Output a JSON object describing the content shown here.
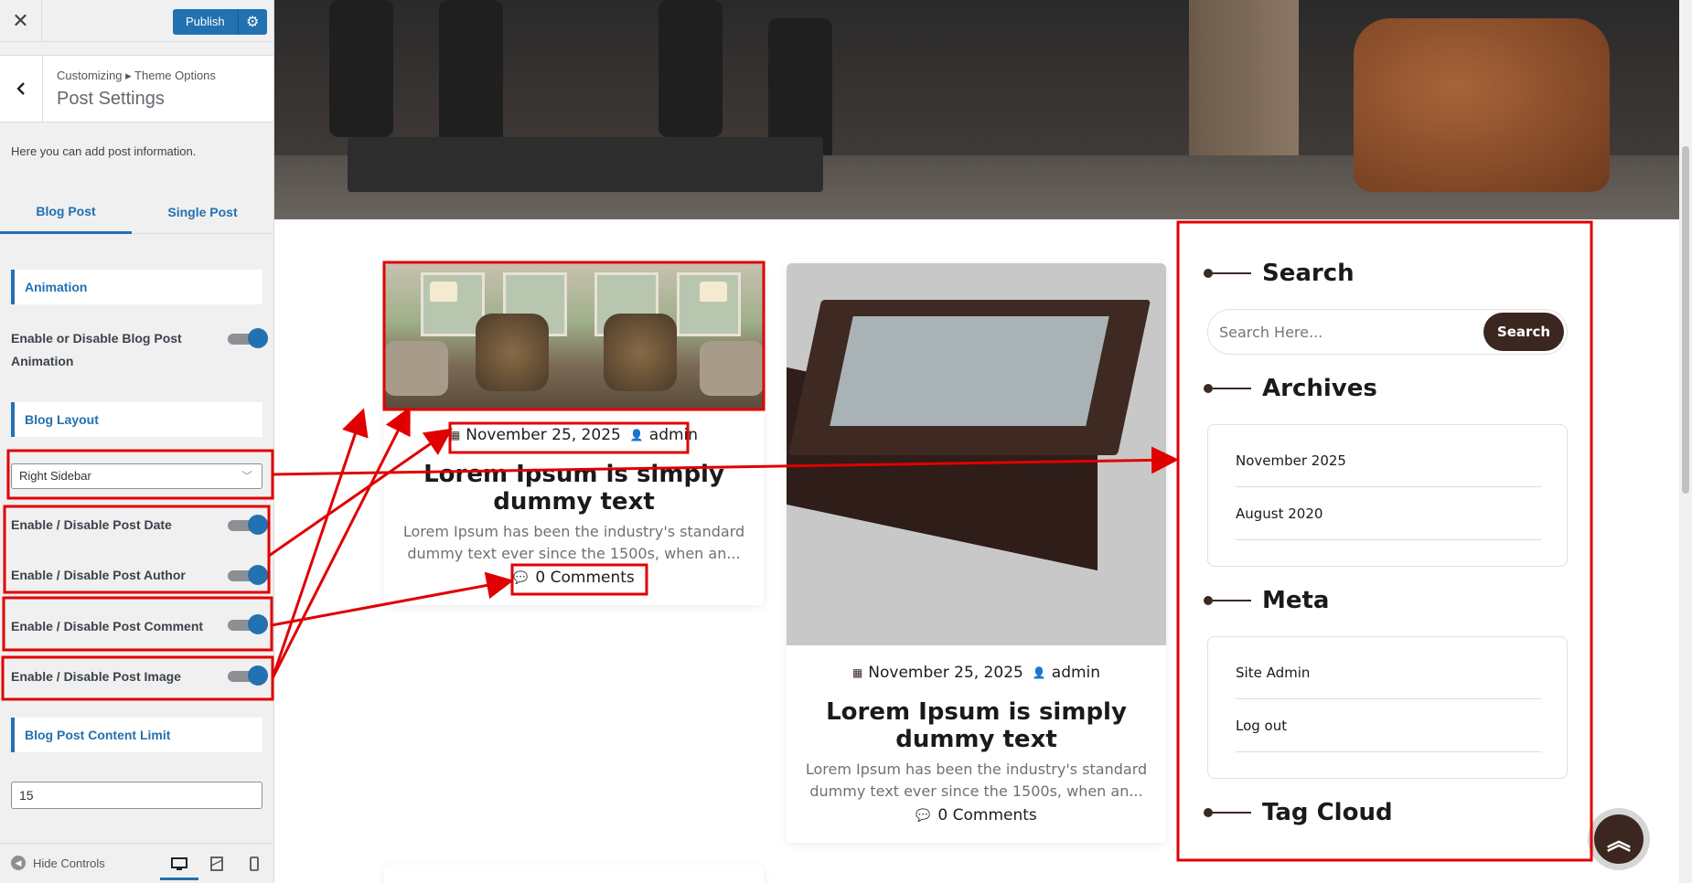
{
  "customizer": {
    "close_icon": "close-icon",
    "publish_label": "Publish",
    "breadcrumb": "Customizing ▸ Theme Options",
    "section_title": "Post Settings",
    "description": "Here you can add post information.",
    "tabs": [
      {
        "label": "Blog Post",
        "active": true
      },
      {
        "label": "Single Post",
        "active": false
      }
    ],
    "animation_heading": "Animation",
    "animation_toggle_label": "Enable or Disable Blog Post Animation",
    "layout_heading": "Blog Layout",
    "layout_value": "Right Sidebar",
    "date_toggle_label": "Enable / Disable Post Date",
    "author_toggle_label": "Enable / Disable Post Author",
    "comment_toggle_label": "Enable / Disable Post Comment",
    "image_toggle_label": "Enable / Disable Post Image",
    "content_limit_heading": "Blog Post Content Limit",
    "content_limit_value": "15",
    "hide_controls_label": "Hide Controls",
    "accent_color": "#2271b1"
  },
  "preview": {
    "posts": [
      {
        "date": "November 25, 2025",
        "author": "admin",
        "title": "Lorem Ipsum is simply dummy text",
        "excerpt": "Lorem Ipsum has been the industry's standard dummy text ever since the 1500s, when an...",
        "comments": "0 Comments"
      },
      {
        "date": "November 25, 2025",
        "author": "admin",
        "title": "Lorem Ipsum is simply dummy text",
        "excerpt": "Lorem Ipsum has been the industry's standard dummy text ever since the 1500s, when an...",
        "comments": "0 Comments"
      }
    ],
    "sidebar": {
      "search_title": "Search",
      "search_placeholder": "Search Here...",
      "search_button": "Search",
      "archives_title": "Archives",
      "archives": [
        "November 2025",
        "August 2020"
      ],
      "meta_title": "Meta",
      "meta_links": [
        "Site Admin",
        "Log out"
      ],
      "tag_cloud_title": "Tag Cloud"
    },
    "brand_color": "#3b2620",
    "annotation_color": "#e00000"
  }
}
